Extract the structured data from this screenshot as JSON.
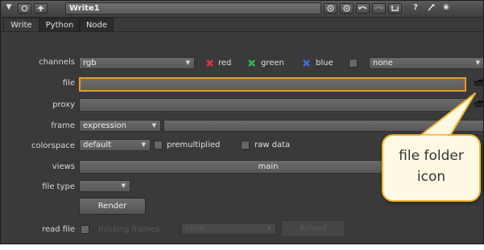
{
  "node": {
    "name": "Write1"
  },
  "titlebar": {
    "collapse_glyph": "▼",
    "help_label": "?",
    "right_button_glyph": "◉"
  },
  "tabs": [
    {
      "label": "Write"
    },
    {
      "label": "Python"
    },
    {
      "label": "Node"
    }
  ],
  "fields": {
    "channels_label": "channels",
    "channels_value": "rgb",
    "red_label": "red",
    "green_label": "green",
    "blue_label": "blue",
    "alpha_value": "none",
    "file_label": "file",
    "file_value": "",
    "proxy_label": "proxy",
    "proxy_value": "",
    "frame_label": "frame",
    "frame_value": "expression",
    "frame_expression": "",
    "colorspace_label": "colorspace",
    "colorspace_value": "default",
    "premultiplied_label": "premultiplied",
    "raw_data_label": "raw data",
    "views_label": "views",
    "views_value": "main",
    "file_type_label": "file type",
    "file_type_value": "",
    "render_label": "Render",
    "read_file_label": "read file",
    "missing_frames_label": "missing frames",
    "missing_frames_value": "error",
    "reload_label": "Reload"
  },
  "callout": {
    "text": "file folder icon"
  },
  "colors": {
    "panel_bg": "#3a3a3a",
    "file_field_border": "#e89a2c",
    "red_check": "#e0313a",
    "green_check": "#2fb84a",
    "blue_check": "#3a6ee0",
    "callout_border": "#f0b634",
    "callout_bg": "#fff9e3"
  },
  "icons": {
    "file_browse": "folder-icon",
    "proxy_browse": "folder-icon"
  }
}
